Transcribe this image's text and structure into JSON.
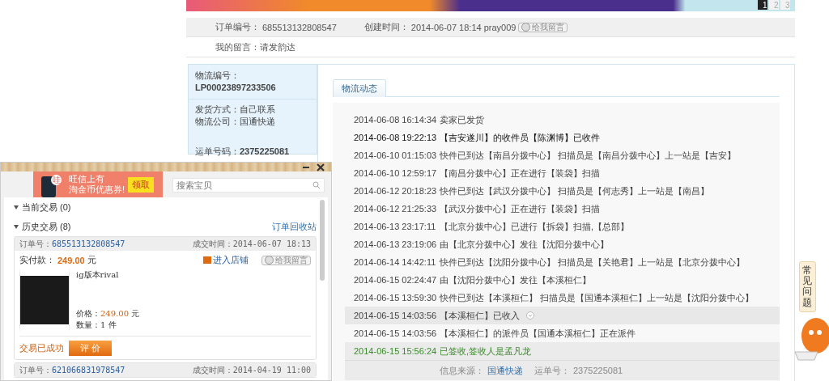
{
  "banner": {
    "pages": [
      {
        "label": "1",
        "selected": true
      },
      {
        "label": "2",
        "selected": false
      },
      {
        "label": "3",
        "selected": false
      }
    ]
  },
  "order_bar": {
    "order_no_label": "订单编号：",
    "order_no": "685513132808547",
    "created_label": "创建时间：",
    "created": "2014-06-07 18:14",
    "buyer": "pray009",
    "message_button": "给我留言"
  },
  "my_message": {
    "label": "我的留言：",
    "text": "请发韵达"
  },
  "logistics_info": {
    "tracking_label": "物流编号：",
    "tracking_no": "LP00023897233506",
    "method": "发货方式：自己联系",
    "company": "物流公司：国通快递",
    "waybill_label": "运单号码：",
    "waybill": "2375225081"
  },
  "tabs": [
    {
      "label": "物流动态",
      "selected": true
    }
  ],
  "events": [
    {
      "time": "2014-06-08 16:14:34",
      "text": "卖家已发货",
      "kind": "normal"
    },
    {
      "time": "2014-06-08 19:22:13",
      "text": "【吉安遂川】的收件员【陈渊博】已收件",
      "kind": "dark"
    },
    {
      "time": "2014-06-10 01:15:03",
      "text": "快件已到达【南昌分拨中心】 扫描员是【南昌分拨中心】上一站是【吉安】",
      "kind": "normal"
    },
    {
      "time": "2014-06-10 12:59:17",
      "text": "【南昌分拨中心】正在进行【装袋】扫描",
      "kind": "normal"
    },
    {
      "time": "2014-06-12 20:18:23",
      "text": "快件已到达【武汉分拨中心】 扫描员是【何志秀】上一站是【南昌】",
      "kind": "normal"
    },
    {
      "time": "2014-06-12 21:25:33",
      "text": "【武汉分拨中心】正在进行【装袋】扫描",
      "kind": "normal"
    },
    {
      "time": "2014-06-13 23:17:11",
      "text": "【北京分拨中心】已进行【拆袋】扫描,【总部】",
      "kind": "normal"
    },
    {
      "time": "2014-06-13 23:19:06",
      "text": "由【北京分拨中心】发往【沈阳分拨中心】",
      "kind": "normal"
    },
    {
      "time": "2014-06-14 14:42:11",
      "text": "快件已到达【沈阳分拨中心】 扫描员是【关艳君】上一站是【北京分拨中心】",
      "kind": "normal"
    },
    {
      "time": "2014-06-15 02:24:47",
      "text": "由【沈阳分拨中心】发往【本溪桓仁】",
      "kind": "normal"
    },
    {
      "time": "2014-06-15 13:59:30",
      "text": "快件已到达【本溪桓仁】 扫描员是【国通本溪桓仁】上一站是【沈阳分拨中心】",
      "kind": "normal"
    },
    {
      "time": "2014-06-15 14:03:56",
      "text": "【本溪桓仁】已收入",
      "kind": "hover"
    },
    {
      "time": "2014-06-15 14:03:56",
      "text": "【本溪桓仁】的派件员【国通本溪桓仁】正在派件",
      "kind": "normal"
    },
    {
      "time": "2014-06-15 15:56:24",
      "text": "已签收,签收人是孟凡龙",
      "kind": "signed"
    }
  ],
  "source": {
    "label": "信息来源：",
    "company": "国通快递",
    "waybill_label": "运单号：",
    "waybill": "2375225081"
  },
  "faq_tab": "常见问题",
  "widget": {
    "promo": {
      "badge": "哇",
      "line_1": "旺信上有",
      "line_2": "淘金币优惠券!",
      "button": "领取"
    },
    "search": {
      "placeholder": "搜索宝贝"
    },
    "sections": [
      {
        "label": "当前交易 (0)",
        "expanded": true
      },
      {
        "label": "历史交易 (8)",
        "expanded": true,
        "link": "订单回收站"
      }
    ],
    "orders": [
      {
        "order_label": "订单号：",
        "order_no": "685513132808547",
        "time": "成交时间：2014-06-07 18:13",
        "paid_label": "实付款：",
        "paid": "249.00",
        "currency": "元",
        "shop_link": "进入店铺",
        "message_button": "给我留言",
        "title": "ig版本rival",
        "price_label": "价格：",
        "price": "249.00",
        "price_currency": "元",
        "quantity": "数量：1 件",
        "status": "交易已成功",
        "review_button": "评 价"
      },
      {
        "order_label": "订单号：",
        "order_no": "621066831978547",
        "time": "成交时间：2014-04-19 11:00"
      }
    ]
  }
}
